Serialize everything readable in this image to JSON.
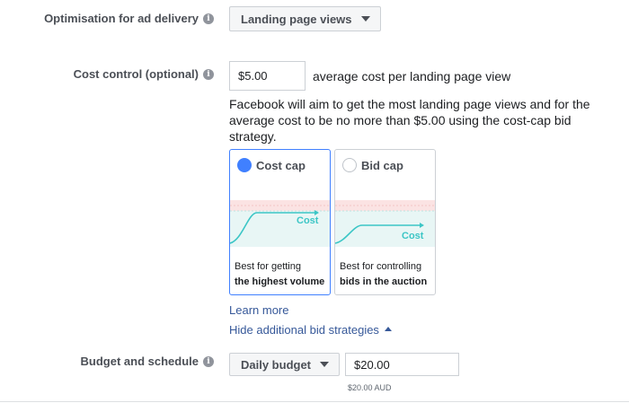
{
  "delivery": {
    "label": "Optimisation for ad delivery",
    "value": "Landing page views"
  },
  "cost_control": {
    "label": "Cost control (optional)",
    "value": "$5.00",
    "unit_text": "average cost per landing page view",
    "description": "Facebook will aim to get the most landing page views and for the average cost to be no more than $5.00 using the cost-cap bid strategy."
  },
  "strategies": [
    {
      "title": "Cost cap",
      "selected": true,
      "chart_label": "Cost",
      "desc_line1": "Best for getting",
      "desc_line2": "the highest volume"
    },
    {
      "title": "Bid cap",
      "selected": false,
      "chart_label": "Cost",
      "desc_line1": "Best for controlling",
      "desc_line2": "bids in the auction"
    }
  ],
  "links": {
    "learn_more": "Learn more",
    "hide_strategies": "Hide additional bid strategies"
  },
  "budget": {
    "label": "Budget and schedule",
    "type": "Daily budget",
    "amount": "$20.00",
    "amount_sub": "$20.00 AUD"
  },
  "icons": {
    "info": "info-icon",
    "caret": "caret-down-icon",
    "check": "check-icon"
  },
  "colors": {
    "accent": "#4080ff",
    "link": "#365899",
    "chart_line": "#3cc6c6",
    "chart_band": "#e8f6f5",
    "cap_band": "#fbe3e3"
  }
}
